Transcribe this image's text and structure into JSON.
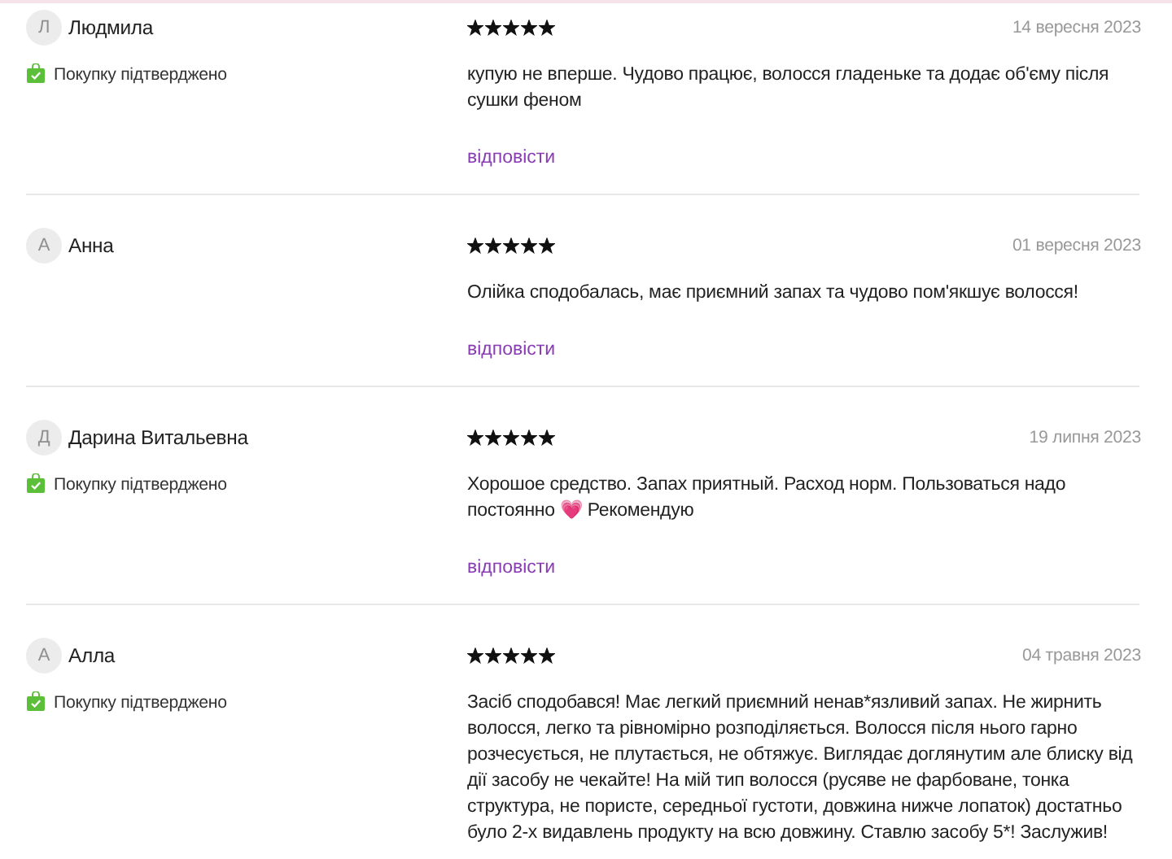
{
  "reviews": [
    {
      "initial": "Л",
      "name": "Людмила",
      "verified": true,
      "verified_label": "Покупку підтверджено",
      "stars": 5,
      "date": "14 вересня 2023",
      "text": "купую не вперше. Чудово працює, волосся гладеньке та додає об'єму після сушки феном",
      "reply": "відповісти"
    },
    {
      "initial": "А",
      "name": "Анна",
      "verified": false,
      "stars": 5,
      "date": "01 вересня 2023",
      "text": "Олійка сподобалась, має приємний запах та чудово пом'якшує волосся!",
      "reply": "відповісти"
    },
    {
      "initial": "Д",
      "name": "Дарина Витальевна",
      "verified": true,
      "verified_label": "Покупку підтверджено",
      "stars": 5,
      "date": "19 липня 2023",
      "text": "Хорошое средство. Запах приятный. Расход норм. Пользоваться надо постоянно 💗 Рекомендую",
      "reply": "відповісти"
    },
    {
      "initial": "А",
      "name": "Алла",
      "verified": true,
      "verified_label": "Покупку підтверджено",
      "stars": 5,
      "date": "04 травня 2023",
      "text": "Засіб сподобався! Має легкий приємний ненав*язливий запах. Не жирнить волосся, легко та рівномірно розподіляється. Волосся після нього гарно розчесується, не плутається, не обтяжує. Виглядає доглянутим але блиску від дії засобу не чекайте! На мій тип волосся (русяве не фарбоване, тонка структура, не пористе, середньої густоти, довжина нижче лопаток) достатньо було 2-х видавлень продукту на всю довжину. Ставлю засобу 5*! Заслужив!"
    }
  ]
}
